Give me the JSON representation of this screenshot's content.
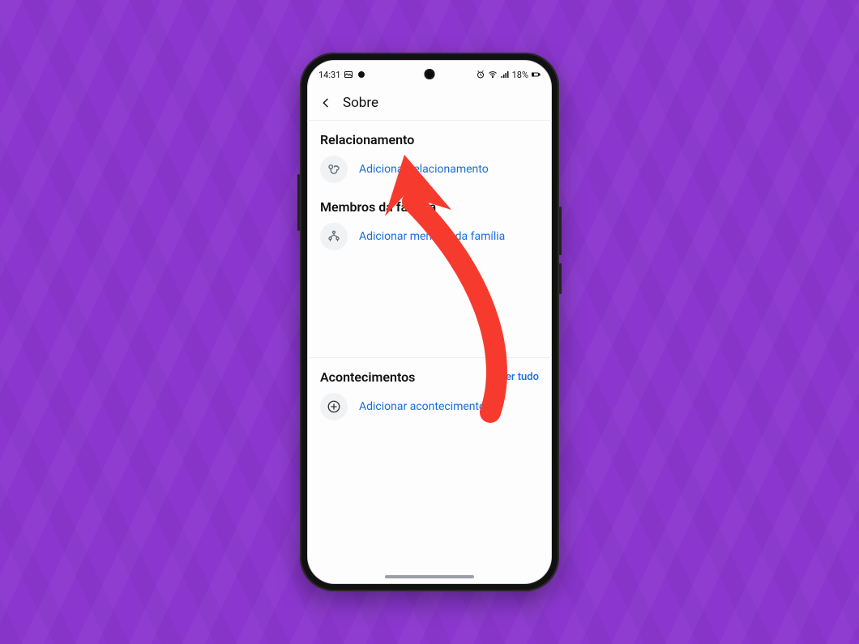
{
  "statusbar": {
    "time": "14:31",
    "battery_text": "18%"
  },
  "appbar": {
    "title": "Sobre"
  },
  "sections": {
    "relationship": {
      "title": "Relacionamento",
      "add_label": "Adicionar relacionamento"
    },
    "family": {
      "title": "Membros da família",
      "add_label": "Adicionar membro da família"
    },
    "events": {
      "title": "Acontecimentos",
      "view_all": "Ver tudo",
      "add_label": "Adicionar acontecimento"
    }
  },
  "colors": {
    "link": "#1a6fd6",
    "accent_arrow": "#f63b2e",
    "bg": "#8b37cf"
  }
}
